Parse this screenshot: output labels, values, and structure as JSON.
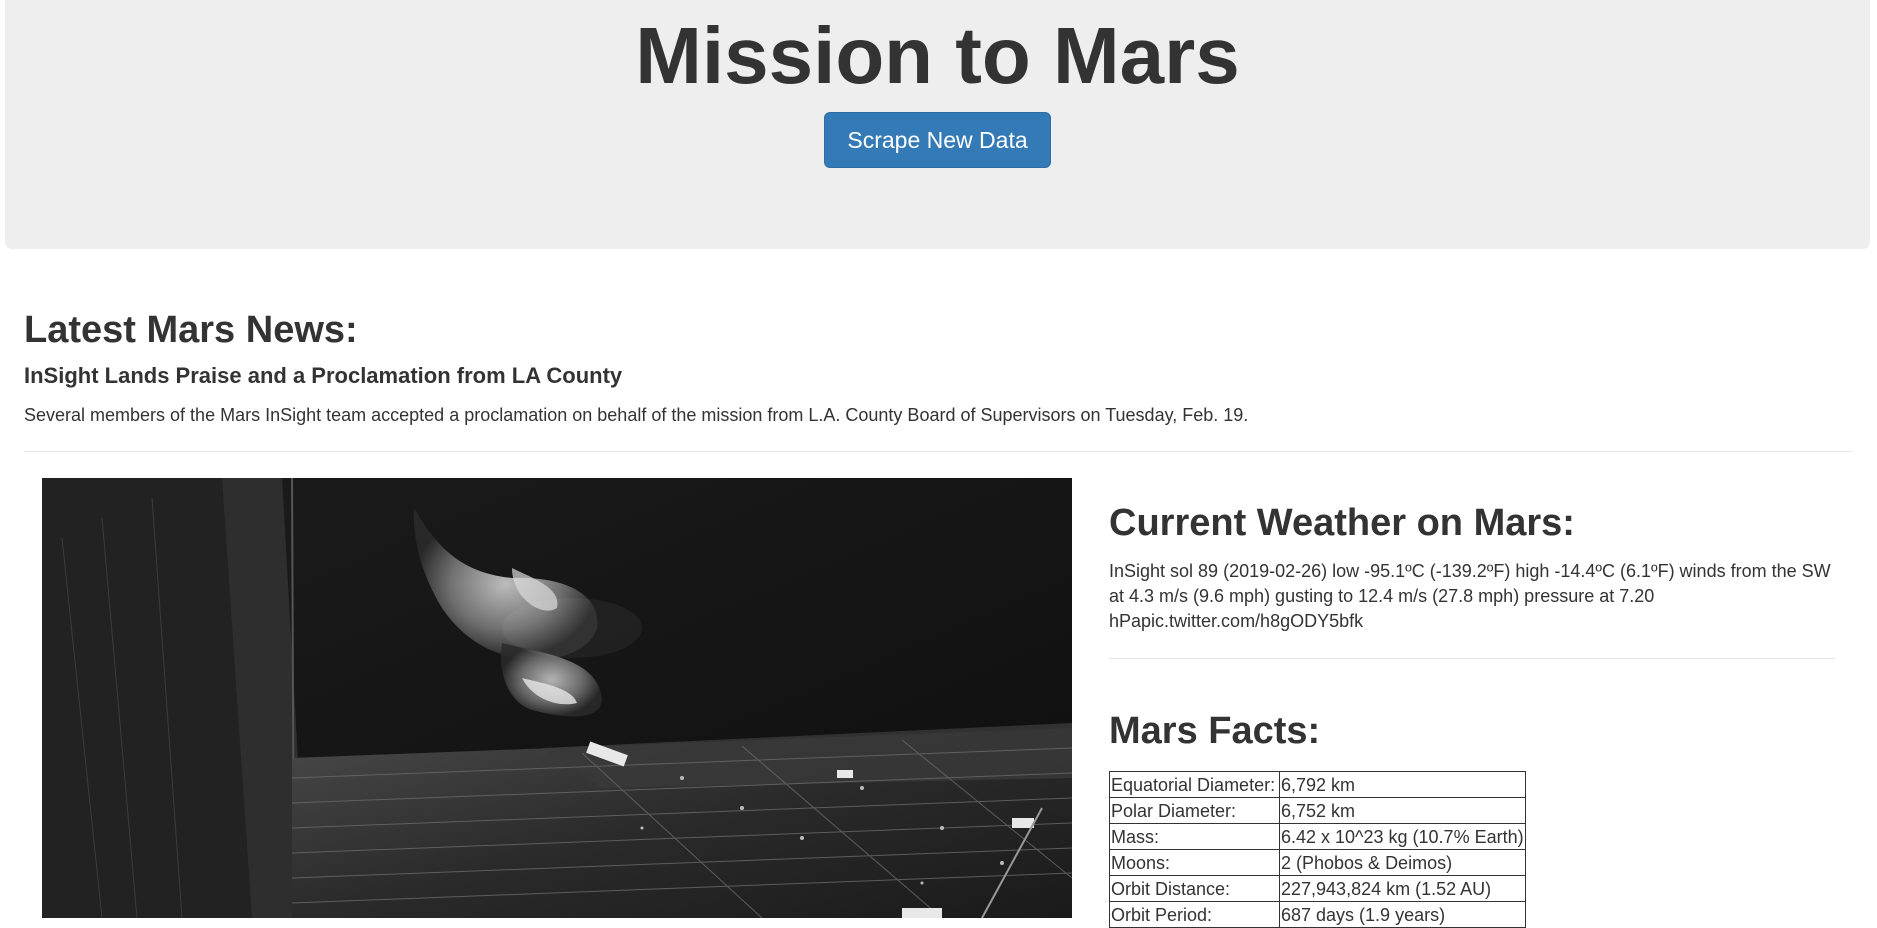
{
  "header": {
    "title": "Mission to Mars",
    "scrape_button_label": "Scrape New Data"
  },
  "news": {
    "section_title": "Latest Mars News:",
    "headline": "InSight Lands Praise and a Proclamation from LA County",
    "teaser": "Several members of the Mars InSight team accepted a proclamation on behalf of the mission from L.A. County Board of Supervisors on Tuesday, Feb. 19."
  },
  "weather": {
    "section_title": "Current Weather on Mars:",
    "report": "InSight sol 89 (2019-02-26) low -95.1ºC (-139.2ºF) high -14.4ºC (6.1ºF) winds from the SW at 4.3 m/s (9.6 mph) gusting to 12.4 m/s (27.8 mph) pressure at 7.20 hPapic.twitter.com/h8gODY5bfk"
  },
  "facts": {
    "section_title": "Mars Facts:",
    "rows": [
      {
        "label": "Equatorial Diameter:",
        "value": "6,792 km"
      },
      {
        "label": "Polar Diameter:",
        "value": "6,752 km"
      },
      {
        "label": "Mass:",
        "value": "6.42 x 10^23 kg (10.7% Earth)"
      },
      {
        "label": "Moons:",
        "value": "2 (Phobos & Deimos)"
      },
      {
        "label": "Orbit Distance:",
        "value": "227,943,824 km (1.52 AU)"
      },
      {
        "label": "Orbit Period:",
        "value": "687 days (1.9 years)"
      }
    ]
  },
  "featured_image": {
    "subject": "featured-space-image"
  }
}
